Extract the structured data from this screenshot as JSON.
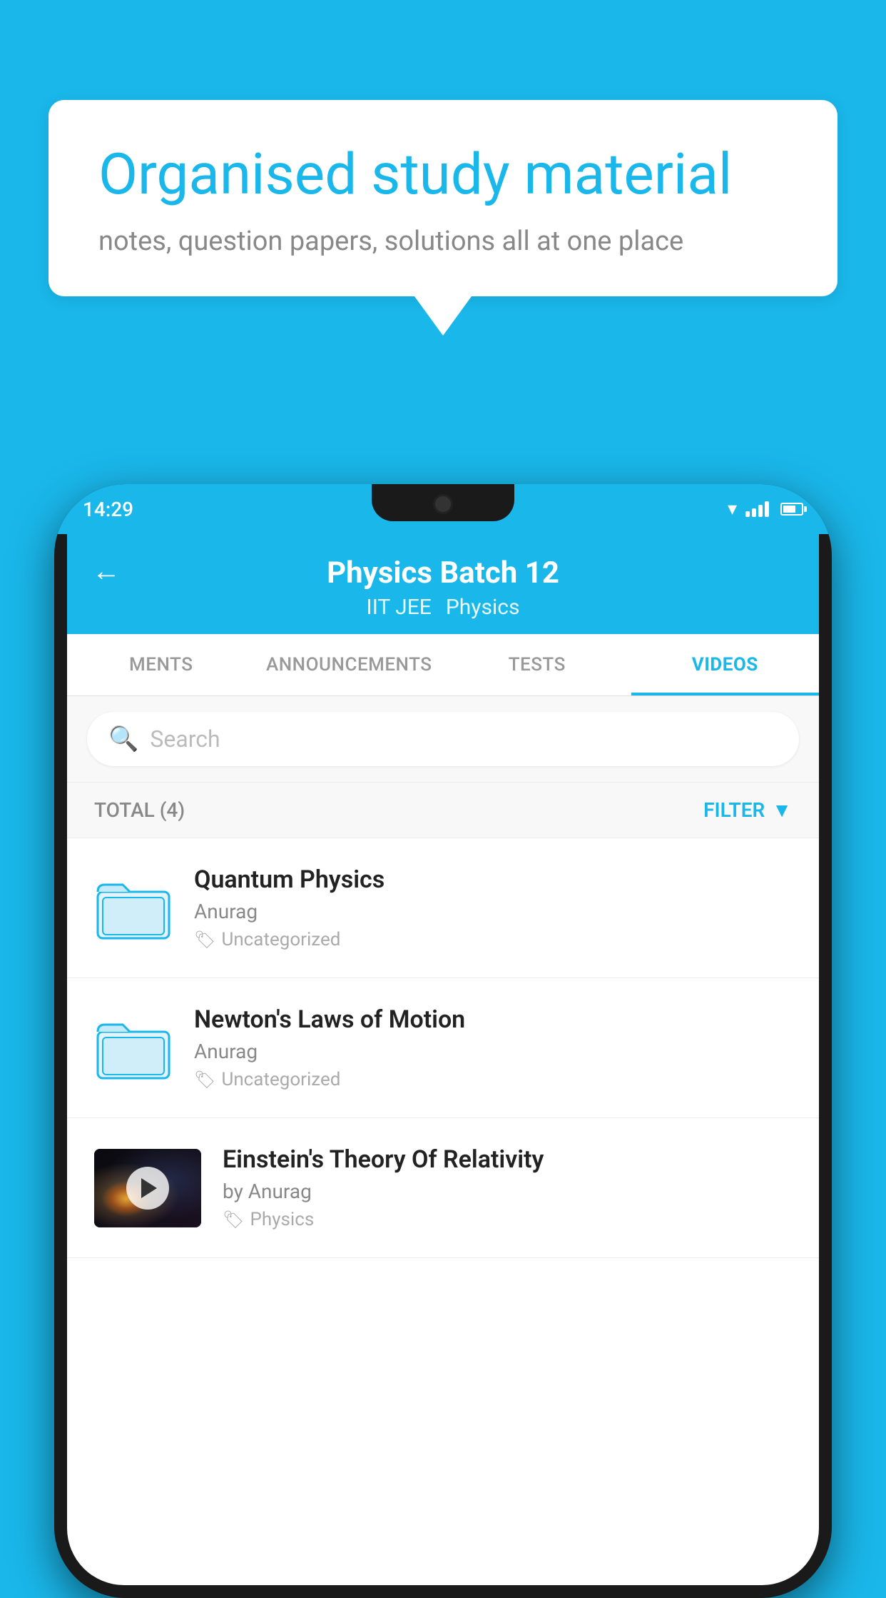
{
  "background_color": "#1ab7ea",
  "speech_bubble": {
    "title": "Organised study material",
    "subtitle": "notes, question papers, solutions all at one place"
  },
  "phone": {
    "status_bar": {
      "time": "14:29"
    },
    "header": {
      "back_arrow": "←",
      "title": "Physics Batch 12",
      "tag1": "IIT JEE",
      "tag2": "Physics"
    },
    "tabs": [
      {
        "label": "MENTS",
        "active": false
      },
      {
        "label": "ANNOUNCEMENTS",
        "active": false
      },
      {
        "label": "TESTS",
        "active": false
      },
      {
        "label": "VIDEOS",
        "active": true
      }
    ],
    "search": {
      "placeholder": "Search"
    },
    "filter_bar": {
      "total_label": "TOTAL (4)",
      "filter_label": "FILTER"
    },
    "videos": [
      {
        "id": 1,
        "title": "Quantum Physics",
        "author": "Anurag",
        "tag": "Uncategorized",
        "has_thumb": false
      },
      {
        "id": 2,
        "title": "Newton's Laws of Motion",
        "author": "Anurag",
        "tag": "Uncategorized",
        "has_thumb": false
      },
      {
        "id": 3,
        "title": "Einstein's Theory Of Relativity",
        "author": "by Anurag",
        "tag": "Physics",
        "has_thumb": true
      }
    ]
  }
}
